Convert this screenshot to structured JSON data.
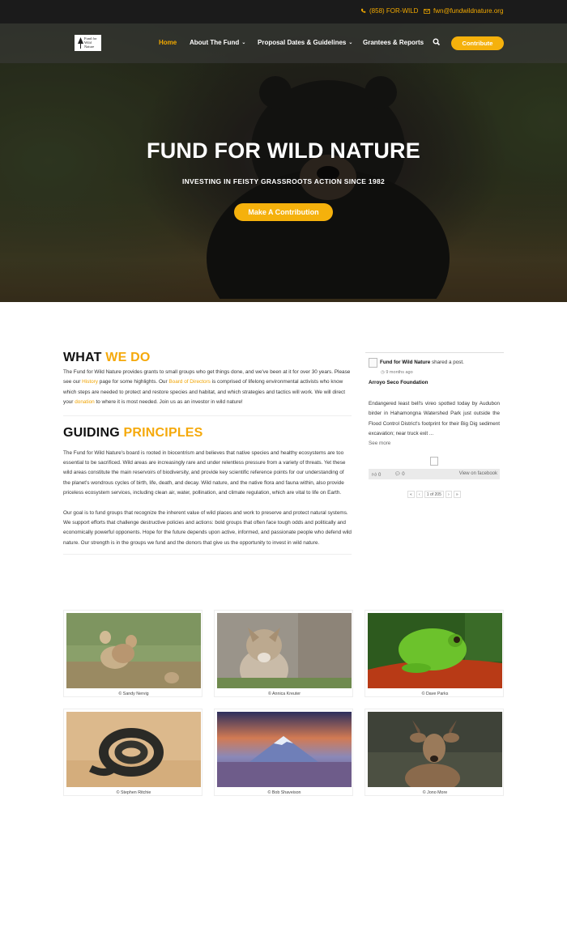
{
  "topbar": {
    "phone": "(858) FOR-WILD",
    "email": "fwn@fundwildnature.org"
  },
  "logo": {
    "line1": "Fund for",
    "line2": "Wild",
    "line3": "Nature"
  },
  "nav": {
    "items": [
      {
        "label": "Home",
        "active": true
      },
      {
        "label": "About The Fund",
        "dropdown": true
      },
      {
        "label": "Proposal Dates & Guidelines",
        "dropdown": true
      },
      {
        "label": "Grantees & Reports"
      }
    ],
    "contribute_label": "Contribute"
  },
  "hero": {
    "title": "FUND FOR WILD NATURE",
    "tagline": "INVESTING IN FEISTY GRASSROOTS ACTION SINCE 1982",
    "cta_label": "Make A Contribution"
  },
  "what_we_do": {
    "heading_main": "WHAT",
    "heading_accent": "WE DO",
    "p1_a": "The Fund for Wild Nature provides grants to small groups who get things done, and we've been at it for over 30 years. Please see our ",
    "p1_link1": "History",
    "p1_b": " page for some highlights. Our ",
    "p1_link2": "Board of Directors",
    "p1_c": " is comprised of lifelong environmental activists who know which steps are needed to protect and restore species and habitat, and which strategies and tactics will work. We will direct your ",
    "p1_link3": "donation",
    "p1_d": " to where it is most needed.  Join us as an investor in wild nature!"
  },
  "guiding_principles": {
    "heading_main": "GUIDING",
    "heading_accent": "PRINCIPLES",
    "p1": "The Fund for Wild Nature's board is rooted in biocentrism and believes that native species and healthy ecosystems are too essential to be sacrificed. Wild areas are increasingly rare and under relentless pressure from a variety of threats. Yet these wild areas constitute the main reservoirs of biodiversity, and provide key scientific reference points for our understanding of the planet's wondrous cycles of birth, life, death, and decay. Wild nature, and the native flora and fauna within, also provide priceless ecosystem services, including clean air, water, pollination, and climate regulation, which are vital to life on Earth.",
    "p2": "Our goal is to fund groups that recognize the inherent value of wild places and work to preserve and protect natural systems. We support efforts that challenge destructive policies and actions: bold groups that often face tough odds and politically and economically powerful opponents. Hope for the future depends upon active, informed, and passionate people who defend wild nature. Our strength is in the groups we fund and the donors that give us the opportunity to invest in wild nature."
  },
  "facebook": {
    "poster_name": "Fund for Wild Nature",
    "poster_action": " shared a post.",
    "time": "9 months ago",
    "org": "Arroyo Seco Foundation",
    "body": "Endangered least bell's vireo spotted today by Audubon birder in Hahamongna Watershed Park just outside the Flood Control District's footprint for their Big Dig sediment excavation; near truck exit ...",
    "see_more": "See more",
    "likes": "0",
    "comments": "0",
    "view_label": "View on facebook",
    "pager_text": "1 of 205",
    "pager_first": "«",
    "pager_prev": "‹",
    "pager_next": "›",
    "pager_last": "»"
  },
  "gallery": [
    {
      "caption": "© Sandy Nervig",
      "subject": "prairie-dogs"
    },
    {
      "caption": "© Annica Kreuter",
      "subject": "coyote"
    },
    {
      "caption": "© Dave Parks",
      "subject": "tree-frog"
    },
    {
      "caption": "© Stephen Ritchie",
      "subject": "rattlesnake"
    },
    {
      "caption": "© Bob Shaveison",
      "subject": "mountain"
    },
    {
      "caption": "© Jono More",
      "subject": "deer"
    }
  ],
  "colors": {
    "accent": "#f5b10c",
    "topbar": "#1b1b1b",
    "link": "#f0a300"
  }
}
